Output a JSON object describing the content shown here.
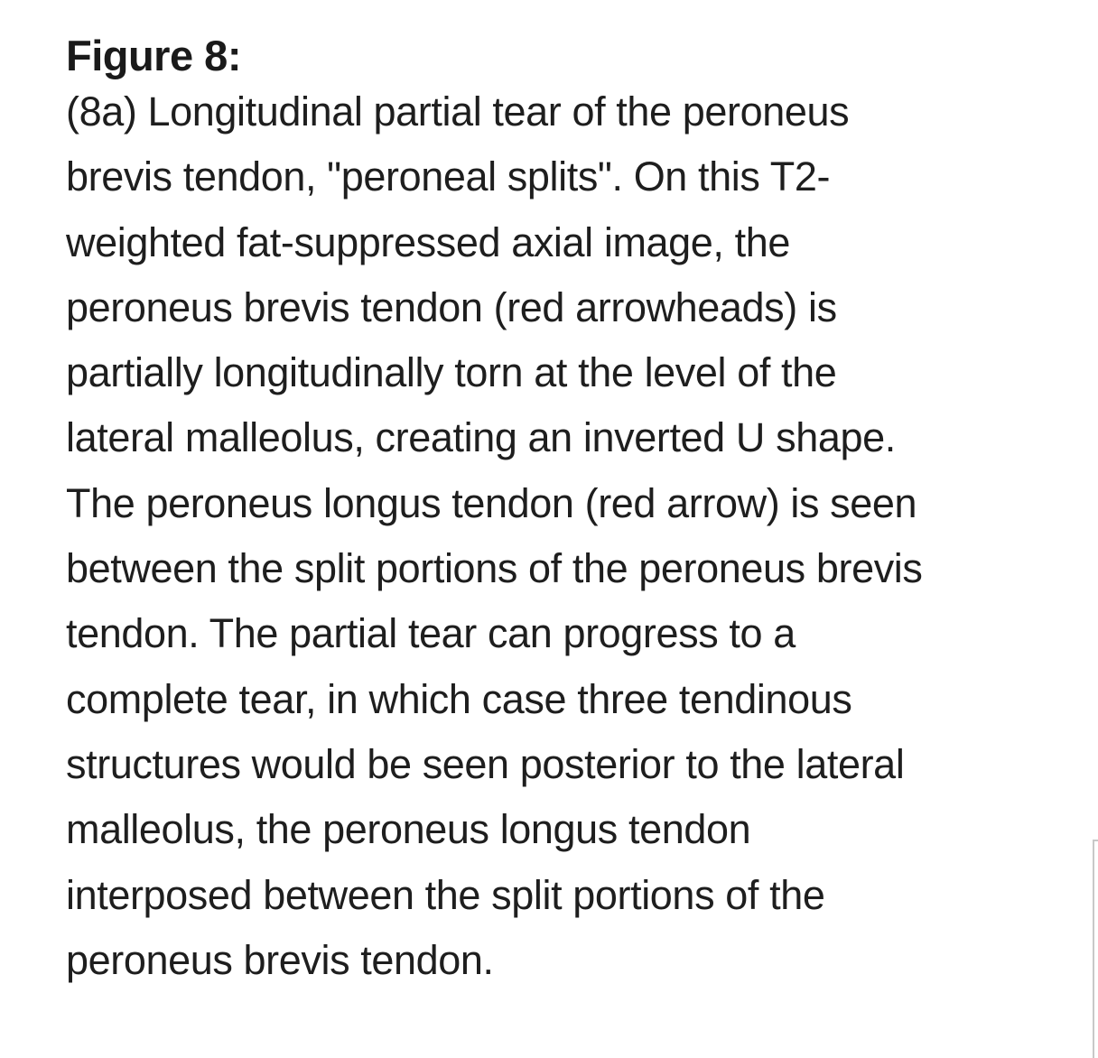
{
  "figure": {
    "title": "Figure 8:",
    "caption_lines": [
      "(8a) Longitudinal partial tear of the peroneus",
      "brevis tendon, \"peroneal splits\". On this T2-",
      "weighted fat-suppressed axial image, the",
      "peroneus brevis tendon (red arrowheads) is",
      "partially longitudinally torn at the level of the",
      "lateral malleolus, creating an inverted U shape.",
      "The peroneus longus tendon (red arrow) is seen",
      "between the split portions of the peroneus brevis",
      "tendon. The partial tear can progress to a",
      "complete tear, in which case three tendinous",
      "structures would be seen posterior to the lateral",
      "malleolus, the peroneus longus tendon",
      "interposed between the split portions of the",
      "peroneus brevis tendon."
    ]
  }
}
